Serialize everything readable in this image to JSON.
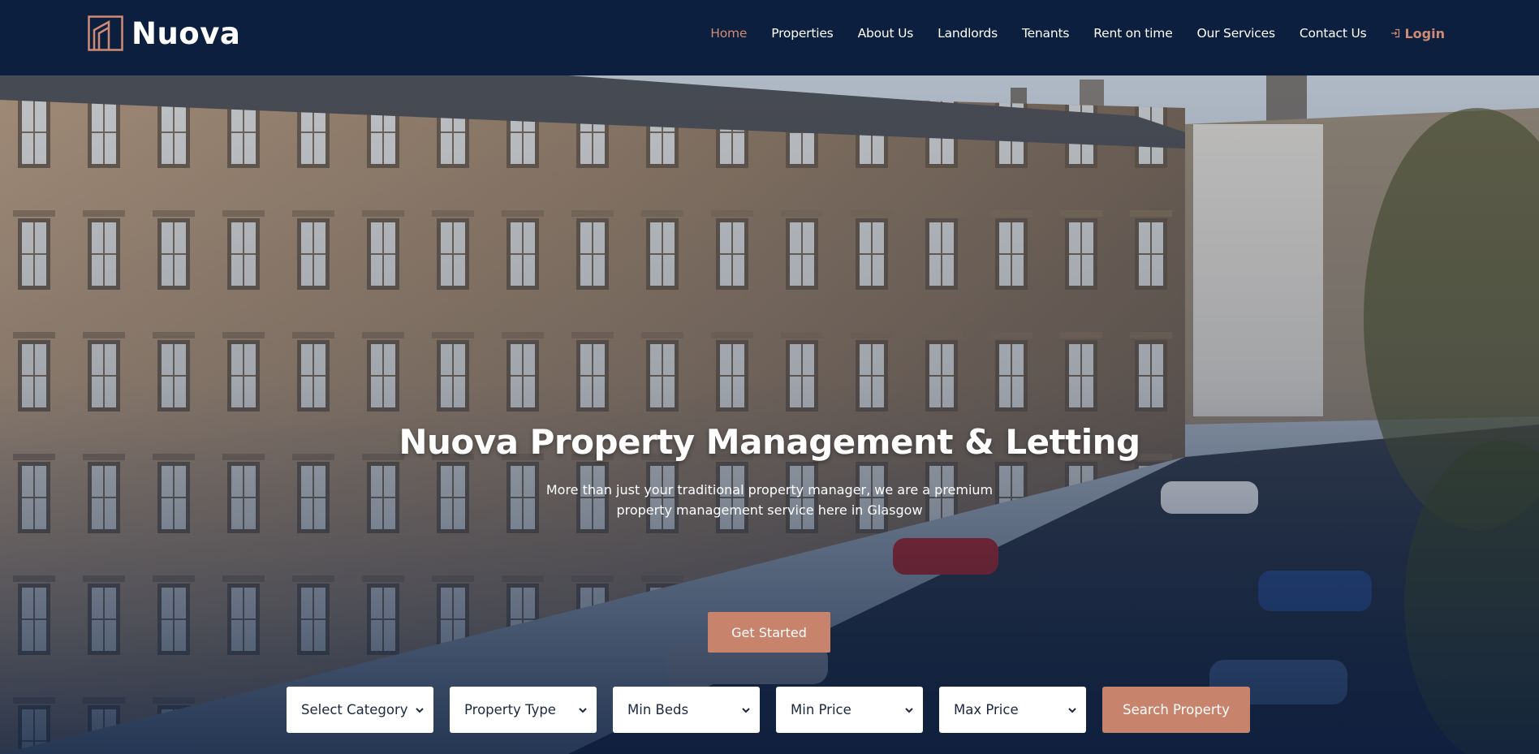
{
  "brand": {
    "name": "Nuova",
    "logo_icon": "house-outline-icon",
    "logo_color": "#d08b74"
  },
  "nav": {
    "items": [
      {
        "label": "Home",
        "active": true
      },
      {
        "label": "Properties"
      },
      {
        "label": "About Us"
      },
      {
        "label": "Landlords"
      },
      {
        "label": "Tenants"
      },
      {
        "label": "Rent on time"
      },
      {
        "label": "Our Services"
      },
      {
        "label": "Contact Us"
      }
    ],
    "login_label": "Login",
    "login_icon": "login-arrow-icon"
  },
  "hero": {
    "title": "Nuova Property Management & Letting",
    "subtitle": "More than just your traditional property manager, we are a premium property management service here in Glasgow",
    "cta_label": "Get Started"
  },
  "search": {
    "filters": [
      {
        "label": "Select Category"
      },
      {
        "label": "Property Type"
      },
      {
        "label": "Min Beds"
      },
      {
        "label": "Min Price"
      },
      {
        "label": "Max Price"
      }
    ],
    "submit_label": "Search Property"
  },
  "colors": {
    "navy": "#0c1f3f",
    "accent": "#c8836c",
    "accent_text": "#d08b74"
  }
}
